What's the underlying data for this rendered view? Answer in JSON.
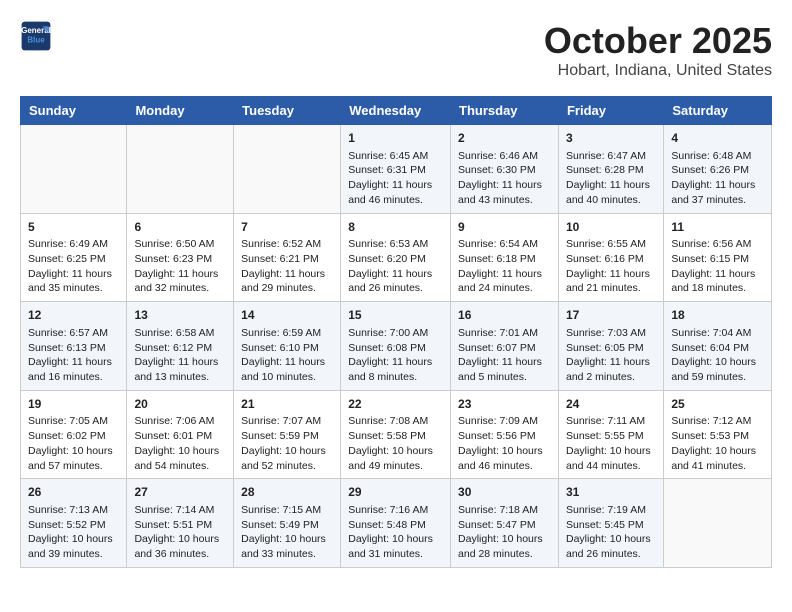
{
  "header": {
    "logo_line1": "General",
    "logo_line2": "Blue",
    "title": "October 2025",
    "subtitle": "Hobart, Indiana, United States"
  },
  "weekdays": [
    "Sunday",
    "Monday",
    "Tuesday",
    "Wednesday",
    "Thursday",
    "Friday",
    "Saturday"
  ],
  "weeks": [
    [
      {
        "day": "",
        "info": ""
      },
      {
        "day": "",
        "info": ""
      },
      {
        "day": "",
        "info": ""
      },
      {
        "day": "1",
        "info": "Sunrise: 6:45 AM\nSunset: 6:31 PM\nDaylight: 11 hours and 46 minutes."
      },
      {
        "day": "2",
        "info": "Sunrise: 6:46 AM\nSunset: 6:30 PM\nDaylight: 11 hours and 43 minutes."
      },
      {
        "day": "3",
        "info": "Sunrise: 6:47 AM\nSunset: 6:28 PM\nDaylight: 11 hours and 40 minutes."
      },
      {
        "day": "4",
        "info": "Sunrise: 6:48 AM\nSunset: 6:26 PM\nDaylight: 11 hours and 37 minutes."
      }
    ],
    [
      {
        "day": "5",
        "info": "Sunrise: 6:49 AM\nSunset: 6:25 PM\nDaylight: 11 hours and 35 minutes."
      },
      {
        "day": "6",
        "info": "Sunrise: 6:50 AM\nSunset: 6:23 PM\nDaylight: 11 hours and 32 minutes."
      },
      {
        "day": "7",
        "info": "Sunrise: 6:52 AM\nSunset: 6:21 PM\nDaylight: 11 hours and 29 minutes."
      },
      {
        "day": "8",
        "info": "Sunrise: 6:53 AM\nSunset: 6:20 PM\nDaylight: 11 hours and 26 minutes."
      },
      {
        "day": "9",
        "info": "Sunrise: 6:54 AM\nSunset: 6:18 PM\nDaylight: 11 hours and 24 minutes."
      },
      {
        "day": "10",
        "info": "Sunrise: 6:55 AM\nSunset: 6:16 PM\nDaylight: 11 hours and 21 minutes."
      },
      {
        "day": "11",
        "info": "Sunrise: 6:56 AM\nSunset: 6:15 PM\nDaylight: 11 hours and 18 minutes."
      }
    ],
    [
      {
        "day": "12",
        "info": "Sunrise: 6:57 AM\nSunset: 6:13 PM\nDaylight: 11 hours and 16 minutes."
      },
      {
        "day": "13",
        "info": "Sunrise: 6:58 AM\nSunset: 6:12 PM\nDaylight: 11 hours and 13 minutes."
      },
      {
        "day": "14",
        "info": "Sunrise: 6:59 AM\nSunset: 6:10 PM\nDaylight: 11 hours and 10 minutes."
      },
      {
        "day": "15",
        "info": "Sunrise: 7:00 AM\nSunset: 6:08 PM\nDaylight: 11 hours and 8 minutes."
      },
      {
        "day": "16",
        "info": "Sunrise: 7:01 AM\nSunset: 6:07 PM\nDaylight: 11 hours and 5 minutes."
      },
      {
        "day": "17",
        "info": "Sunrise: 7:03 AM\nSunset: 6:05 PM\nDaylight: 11 hours and 2 minutes."
      },
      {
        "day": "18",
        "info": "Sunrise: 7:04 AM\nSunset: 6:04 PM\nDaylight: 10 hours and 59 minutes."
      }
    ],
    [
      {
        "day": "19",
        "info": "Sunrise: 7:05 AM\nSunset: 6:02 PM\nDaylight: 10 hours and 57 minutes."
      },
      {
        "day": "20",
        "info": "Sunrise: 7:06 AM\nSunset: 6:01 PM\nDaylight: 10 hours and 54 minutes."
      },
      {
        "day": "21",
        "info": "Sunrise: 7:07 AM\nSunset: 5:59 PM\nDaylight: 10 hours and 52 minutes."
      },
      {
        "day": "22",
        "info": "Sunrise: 7:08 AM\nSunset: 5:58 PM\nDaylight: 10 hours and 49 minutes."
      },
      {
        "day": "23",
        "info": "Sunrise: 7:09 AM\nSunset: 5:56 PM\nDaylight: 10 hours and 46 minutes."
      },
      {
        "day": "24",
        "info": "Sunrise: 7:11 AM\nSunset: 5:55 PM\nDaylight: 10 hours and 44 minutes."
      },
      {
        "day": "25",
        "info": "Sunrise: 7:12 AM\nSunset: 5:53 PM\nDaylight: 10 hours and 41 minutes."
      }
    ],
    [
      {
        "day": "26",
        "info": "Sunrise: 7:13 AM\nSunset: 5:52 PM\nDaylight: 10 hours and 39 minutes."
      },
      {
        "day": "27",
        "info": "Sunrise: 7:14 AM\nSunset: 5:51 PM\nDaylight: 10 hours and 36 minutes."
      },
      {
        "day": "28",
        "info": "Sunrise: 7:15 AM\nSunset: 5:49 PM\nDaylight: 10 hours and 33 minutes."
      },
      {
        "day": "29",
        "info": "Sunrise: 7:16 AM\nSunset: 5:48 PM\nDaylight: 10 hours and 31 minutes."
      },
      {
        "day": "30",
        "info": "Sunrise: 7:18 AM\nSunset: 5:47 PM\nDaylight: 10 hours and 28 minutes."
      },
      {
        "day": "31",
        "info": "Sunrise: 7:19 AM\nSunset: 5:45 PM\nDaylight: 10 hours and 26 minutes."
      },
      {
        "day": "",
        "info": ""
      }
    ]
  ]
}
